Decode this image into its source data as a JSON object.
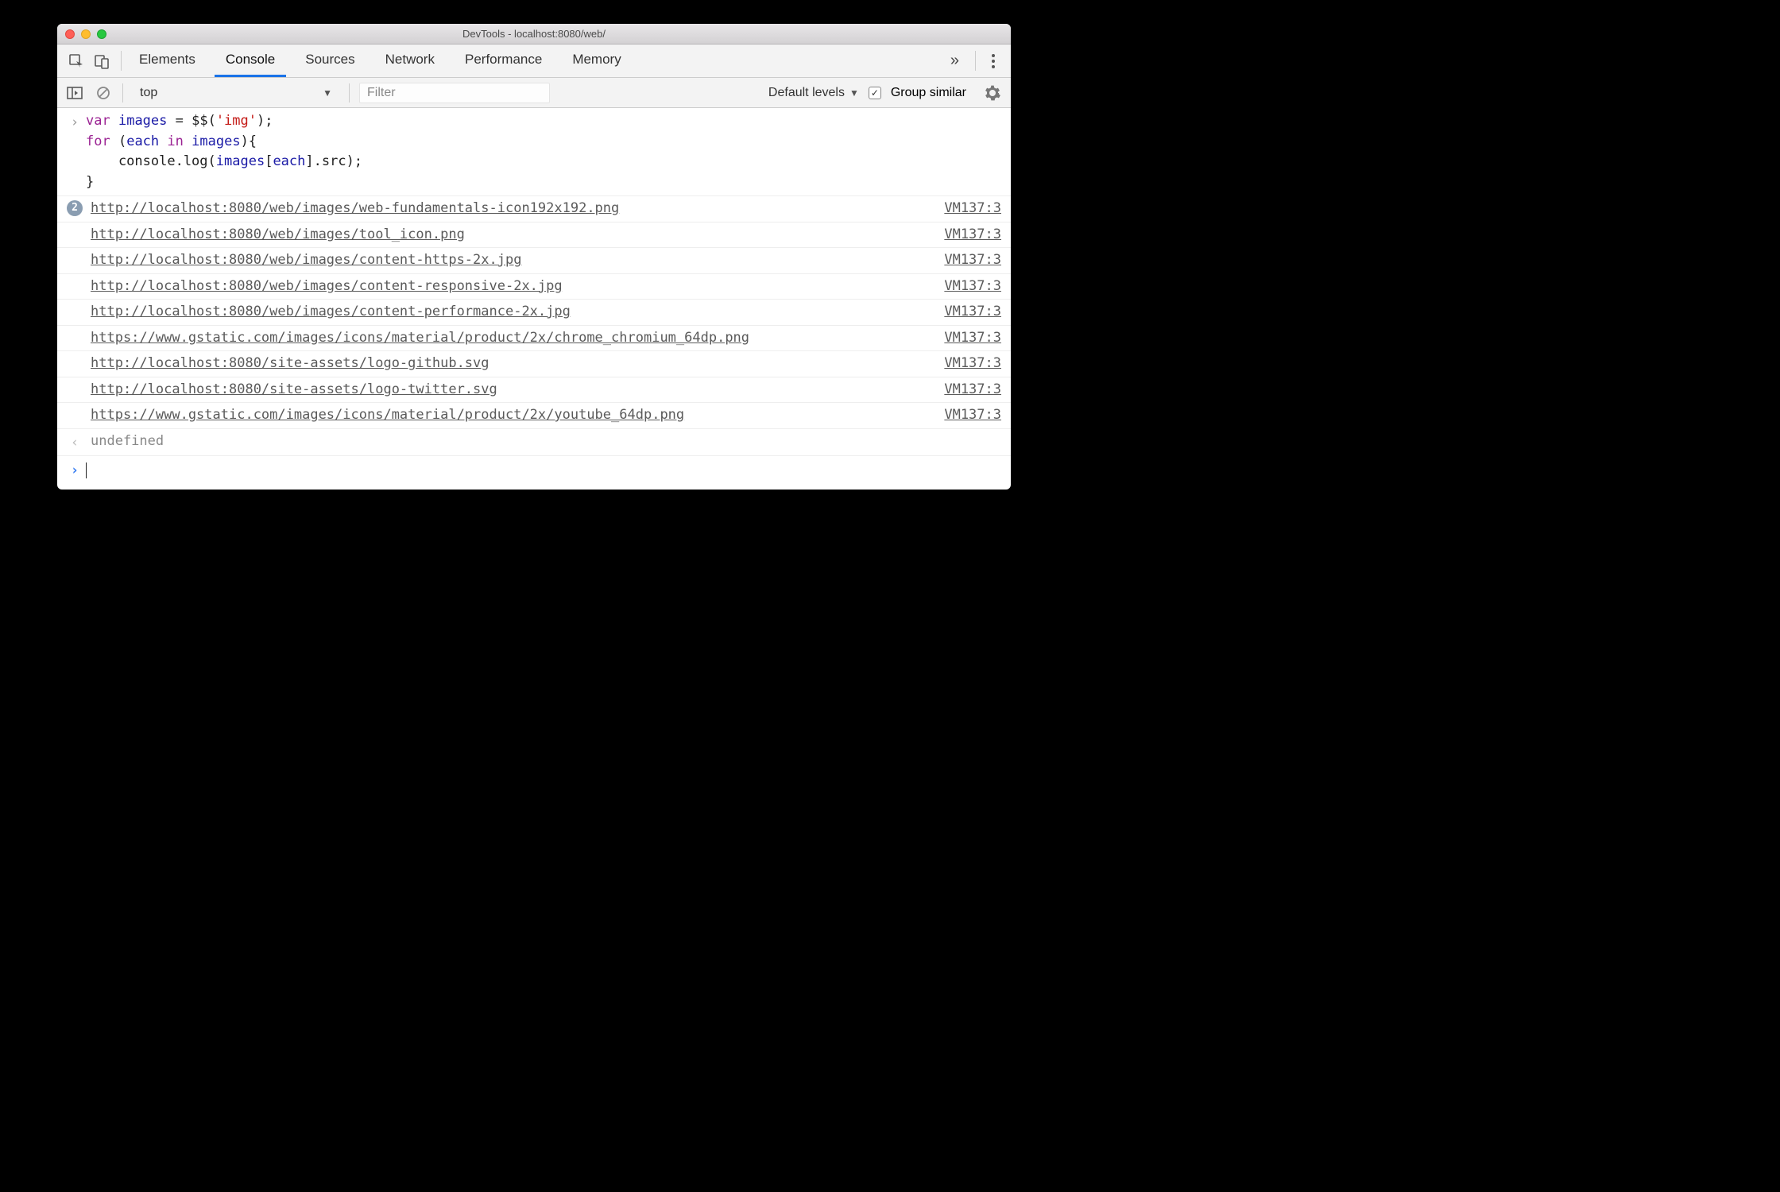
{
  "window": {
    "title": "DevTools - localhost:8080/web/"
  },
  "tabs": {
    "items": [
      "Elements",
      "Console",
      "Sources",
      "Network",
      "Performance",
      "Memory"
    ],
    "active_index": 1,
    "overflow_glyph": "»"
  },
  "toolbar": {
    "context": "top",
    "filter_placeholder": "Filter",
    "levels_label": "Default levels",
    "group_similar_label": "Group similar",
    "group_similar_checked": true
  },
  "input_code": "var images = $$('img');\nfor (each in images){\n    console.log(images[each].src);\n}",
  "logs": [
    {
      "badge": "2",
      "url": "http://localhost:8080/web/images/web-fundamentals-icon192x192.png",
      "src": "VM137:3"
    },
    {
      "url": "http://localhost:8080/web/images/tool_icon.png",
      "src": "VM137:3"
    },
    {
      "url": "http://localhost:8080/web/images/content-https-2x.jpg",
      "src": "VM137:3"
    },
    {
      "url": "http://localhost:8080/web/images/content-responsive-2x.jpg",
      "src": "VM137:3"
    },
    {
      "url": "http://localhost:8080/web/images/content-performance-2x.jpg",
      "src": "VM137:3"
    },
    {
      "url": "https://www.gstatic.com/images/icons/material/product/2x/chrome_chromium_64dp.png",
      "src": "VM137:3"
    },
    {
      "url": "http://localhost:8080/site-assets/logo-github.svg",
      "src": "VM137:3"
    },
    {
      "url": "http://localhost:8080/site-assets/logo-twitter.svg",
      "src": "VM137:3"
    },
    {
      "url": "https://www.gstatic.com/images/icons/material/product/2x/youtube_64dp.png",
      "src": "VM137:3"
    }
  ],
  "return_value": "undefined"
}
